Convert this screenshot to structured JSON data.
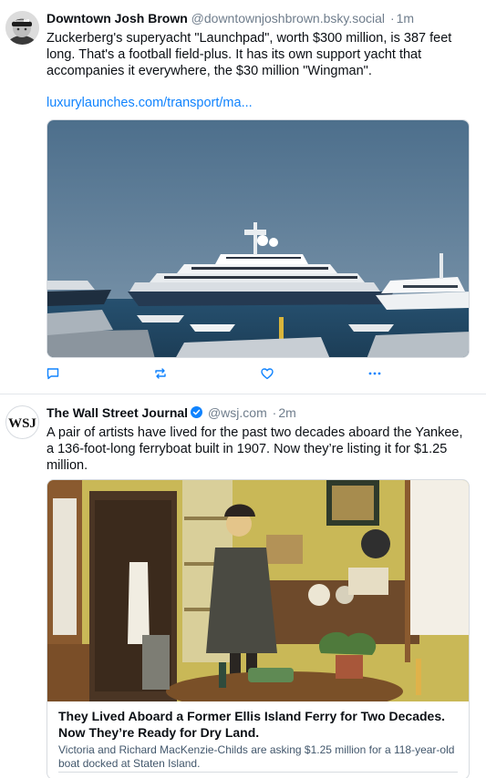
{
  "feed": {
    "posts": [
      {
        "author": {
          "display_name": "Downtown Josh Brown",
          "handle": "@downtownjoshbrown.bsky.social",
          "avatar_icon": "profile-photo"
        },
        "separator": "·",
        "time": "1m",
        "text": "Zuckerberg's superyacht \"Launchpad\", worth $300 million, is 387 feet long. That's a football field-plus. It has its own support yacht that accompanies it everywhere, the $30 million \"Wingman\".",
        "link": "luxurylaunches.com/transport/ma...",
        "image_icon": "superyacht-photo",
        "actions": [
          {
            "icon": "reply-icon"
          },
          {
            "icon": "repost-icon"
          },
          {
            "icon": "like-icon"
          },
          {
            "icon": "more-icon"
          }
        ]
      },
      {
        "author": {
          "display_name": "The Wall Street Journal",
          "handle": "@wsj.com",
          "avatar_text": "WSJ",
          "verified_icon": "verified-badge-icon"
        },
        "separator": "·",
        "time": "2m",
        "text": "A pair of artists have lived for the past two decades aboard the Yankee, a 136-foot-long ferryboat built in 1907. Now they’re listing it for $1.25 million.",
        "card": {
          "image_icon": "ferryboat-interior-photo",
          "title": "They Lived Aboard a Former Ellis Island Ferry for Two Decades. Now They’re Ready for Dry Land.",
          "description": "Victoria and Richard MacKenzie-Childs are asking $1.25 million for a 118-year-old boat docked at Staten Island."
        }
      }
    ]
  },
  "colors": {
    "accent": "#1083fe",
    "text": "#0b0f14",
    "muted": "#6f7d8c",
    "border": "#d7dbe0"
  }
}
